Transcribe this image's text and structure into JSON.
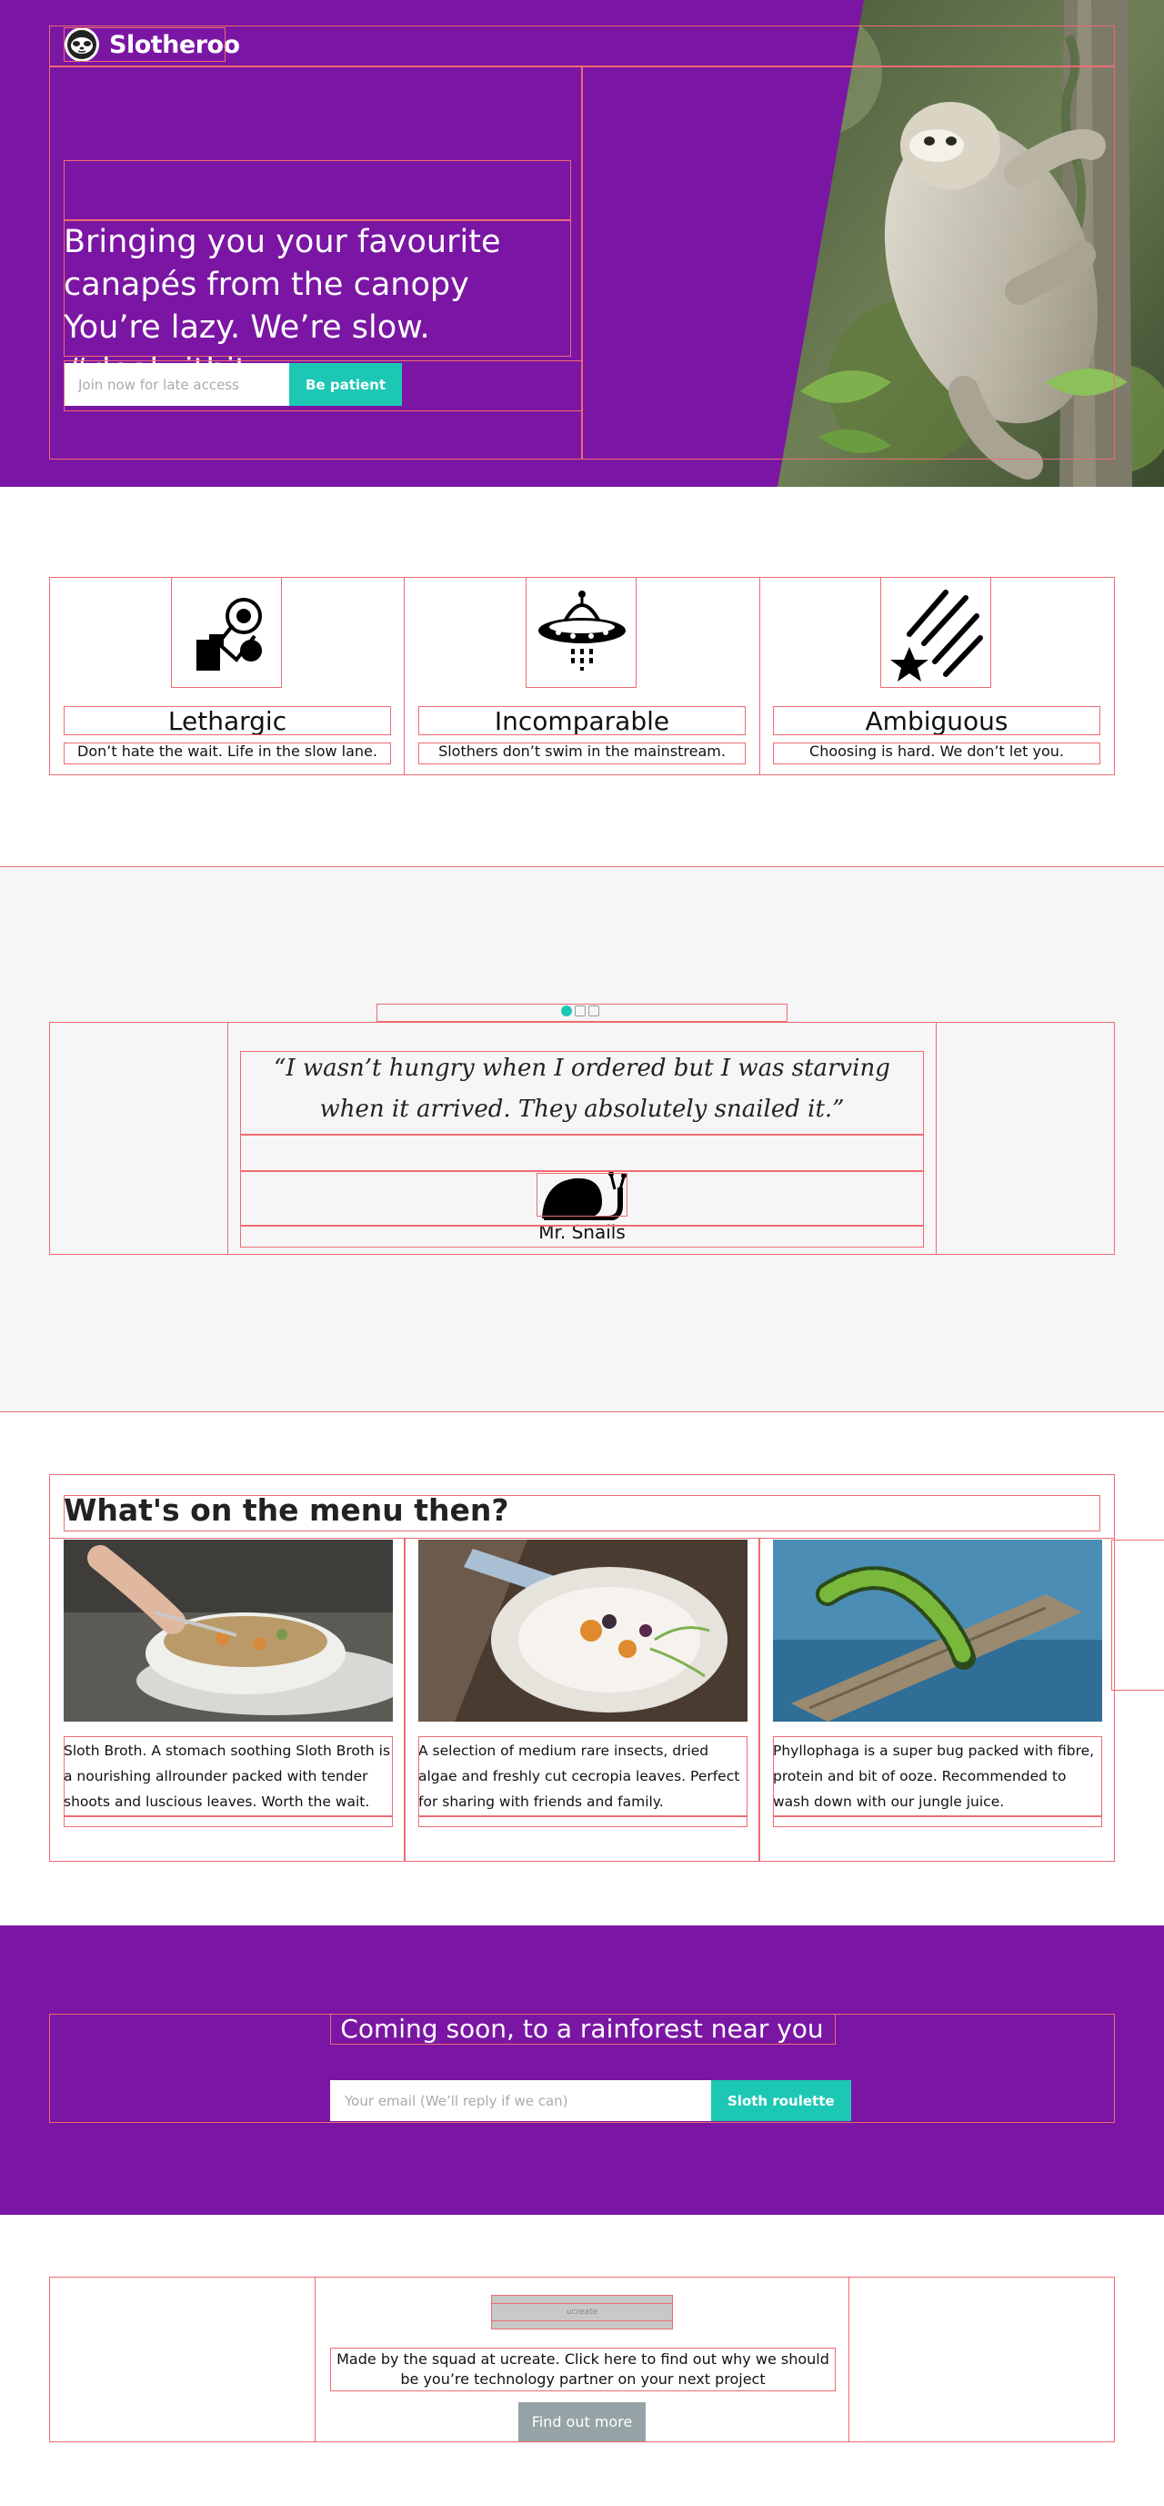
{
  "brand": {
    "name": "Slotheroo",
    "primary_color": "#7a16a3",
    "accent_color": "#1cc8b4",
    "logo_icon": "sloth-face-icon"
  },
  "hero": {
    "title": "Bringing you your favourite canapés from the canopy You’re lazy. We’re slow. #dealwithit",
    "input_placeholder": "Join now for late access",
    "button_label": "Be patient",
    "image_subject": "sloth-climbing-tree"
  },
  "features": [
    {
      "icon": "astronaut-icon",
      "title": "Lethargic",
      "description": "Don’t hate the wait. Life in the slow lane."
    },
    {
      "icon": "ufo-icon",
      "title": "Incomparable",
      "description": "Slothers don’t swim in the mainstream."
    },
    {
      "icon": "shooting-stars-icon",
      "title": "Ambiguous",
      "description": "Choosing is hard. We don’t let you."
    }
  ],
  "testimonial": {
    "quote": "“I wasn’t hungry when I ordered but I was starving when it arrived. They absolutely snailed it.”",
    "author": "Mr. Snails",
    "author_icon": "snail-icon",
    "slides": 3,
    "active_slide": 1
  },
  "menu": {
    "title": "What's on the menu then?",
    "items": [
      {
        "image": "broth-bowl-photo",
        "description": "Sloth Broth. A stomach soothing Sloth Broth is a nourishing allrounder packed with tender shoots and luscious leaves. Worth the wait."
      },
      {
        "image": "insect-salad-photo",
        "description": "A selection of medium rare insects, dried algae and freshly cut cecropia leaves. Perfect for sharing with friends and family."
      },
      {
        "image": "caterpillar-branch-photo",
        "description": "Phyllophaga is a super bug packed with fibre, protein and bit of ooze. Recommended to wash down with our jungle juice."
      }
    ]
  },
  "coming_soon": {
    "title": "Coming soon, to a rainforest near you",
    "input_placeholder": "Your email (We’ll reply if we can)",
    "button_label": "Sloth roulette"
  },
  "footer": {
    "logo_text": "ucreate",
    "text": "Made by the squad at ucreate. Click here to find out why we should be you’re technology partner on your next project",
    "button_label": "Find out more"
  }
}
